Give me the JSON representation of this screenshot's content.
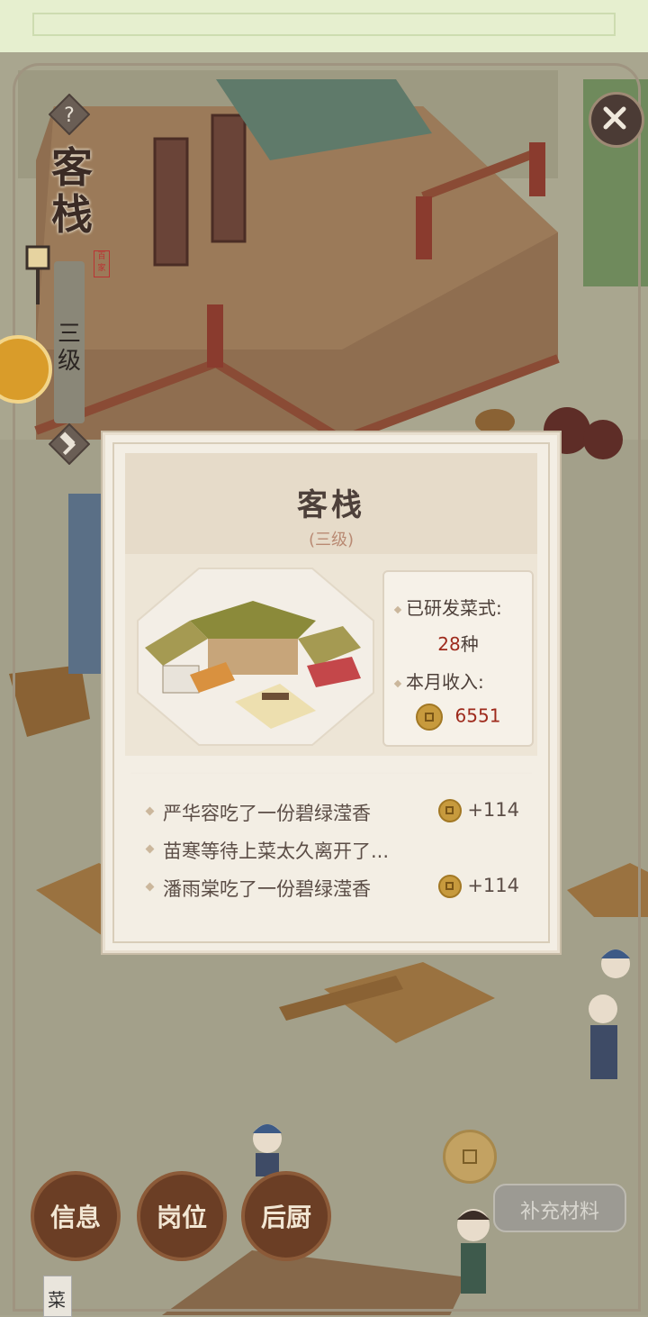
{
  "building": {
    "title": "客栈",
    "level_vertical": "三级",
    "seal_text": "百家"
  },
  "modal": {
    "title": "客栈",
    "subtitle": "(三级)",
    "stats": {
      "dishes_label": "已研发菜式:",
      "dishes_value": "28",
      "dishes_unit": "种",
      "income_label": "本月收入:",
      "income_value": "6551"
    },
    "log": [
      {
        "text": "严华容吃了一份碧绿滢香",
        "reward": "+114"
      },
      {
        "text": "苗寒等待上菜太久离开了...",
        "reward": ""
      },
      {
        "text": "潘雨棠吃了一份碧绿滢香",
        "reward": "+114"
      }
    ]
  },
  "bottom": {
    "btn_info": "信息",
    "btn_post": "岗位",
    "btn_kitchen": "后厨",
    "btn_refill": "补充材料",
    "menu_tab": "菜"
  },
  "colors": {
    "accent_red": "#9e2a1c",
    "button_brown": "#6b3e25",
    "panel_bg": "#f3eee4"
  },
  "icons": {
    "help": "help-icon",
    "close": "close-icon",
    "hammer": "hammer-icon",
    "coin": "coin-icon"
  }
}
